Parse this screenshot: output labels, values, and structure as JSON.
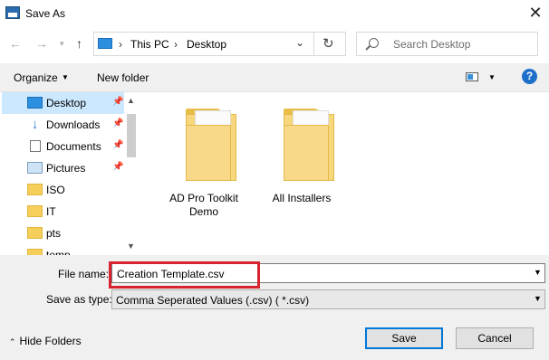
{
  "window": {
    "title": "Save As"
  },
  "nav": {
    "breadcrumbs": [
      "This PC",
      "Desktop"
    ],
    "search_placeholder": "Search Desktop"
  },
  "toolbar": {
    "organize_label": "Organize",
    "new_folder_label": "New folder",
    "help_label": "?"
  },
  "sidebar": {
    "items": [
      {
        "label": "Desktop",
        "icon": "desktop-icon",
        "pinned": true,
        "selected": true
      },
      {
        "label": "Downloads",
        "icon": "download-icon",
        "pinned": true
      },
      {
        "label": "Documents",
        "icon": "document-icon",
        "pinned": true
      },
      {
        "label": "Pictures",
        "icon": "pictures-icon",
        "pinned": true
      },
      {
        "label": "ISO",
        "icon": "folder-icon"
      },
      {
        "label": "IT",
        "icon": "folder-icon"
      },
      {
        "label": "pts",
        "icon": "folder-icon"
      },
      {
        "label": "temp",
        "icon": "folder-icon"
      }
    ]
  },
  "files": {
    "items": [
      {
        "label": "AD Pro Toolkit Demo",
        "icon": "folder-icon"
      },
      {
        "label": "All Installers",
        "icon": "folder-icon"
      }
    ]
  },
  "form": {
    "file_name_label": "File name:",
    "file_name_value": "Creation Template.csv",
    "save_as_type_label": "Save as type:",
    "save_as_type_value": "Comma Seperated Values (.csv) ( *.csv)"
  },
  "footer": {
    "hide_folders_label": "Hide Folders",
    "save_label": "Save",
    "cancel_label": "Cancel"
  },
  "colors": {
    "selection": "#cce8ff",
    "highlight_border": "#d7232f",
    "accent": "#0078d7"
  }
}
